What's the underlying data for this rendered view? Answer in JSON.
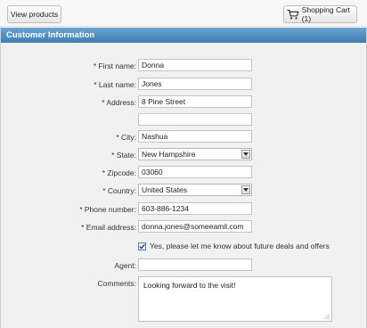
{
  "toolbar": {
    "view_products_label": "View products",
    "cart_label": "Shopping Cart (1)"
  },
  "section": {
    "title": "Customer Information"
  },
  "form": {
    "first_name": {
      "label": "* First name:",
      "value": "Donna"
    },
    "last_name": {
      "label": "* Last name:",
      "value": "Jones"
    },
    "address": {
      "label": "* Address:",
      "value": "8 Pine Street"
    },
    "address2": {
      "value": ""
    },
    "city": {
      "label": "* City:",
      "value": "Nashua"
    },
    "state": {
      "label": "* State:",
      "value": "New Hampshire"
    },
    "zipcode": {
      "label": "* Zipcode:",
      "value": "03060"
    },
    "country": {
      "label": "* Country:",
      "value": "United States"
    },
    "phone": {
      "label": "* Phone number:",
      "value": "603-886-1234"
    },
    "email": {
      "label": "* Email address:",
      "value": "donna.jones@someeamil.com"
    },
    "deals_checkbox": {
      "label": "Yes, please let me know about future deals and offers",
      "checked": true
    },
    "agent": {
      "label": "Agent:",
      "value": ""
    },
    "comments": {
      "label": "Comments:",
      "value": "Looking forward to the visit!"
    }
  },
  "colors": {
    "header_bg": "#4a88bf",
    "panel_bg": "#f1f1f1"
  },
  "icons": {
    "cart": "shopping-cart-icon",
    "select_arrow": "chevron-down-icon",
    "check": "check-icon",
    "resize": "resize-grip-icon"
  }
}
